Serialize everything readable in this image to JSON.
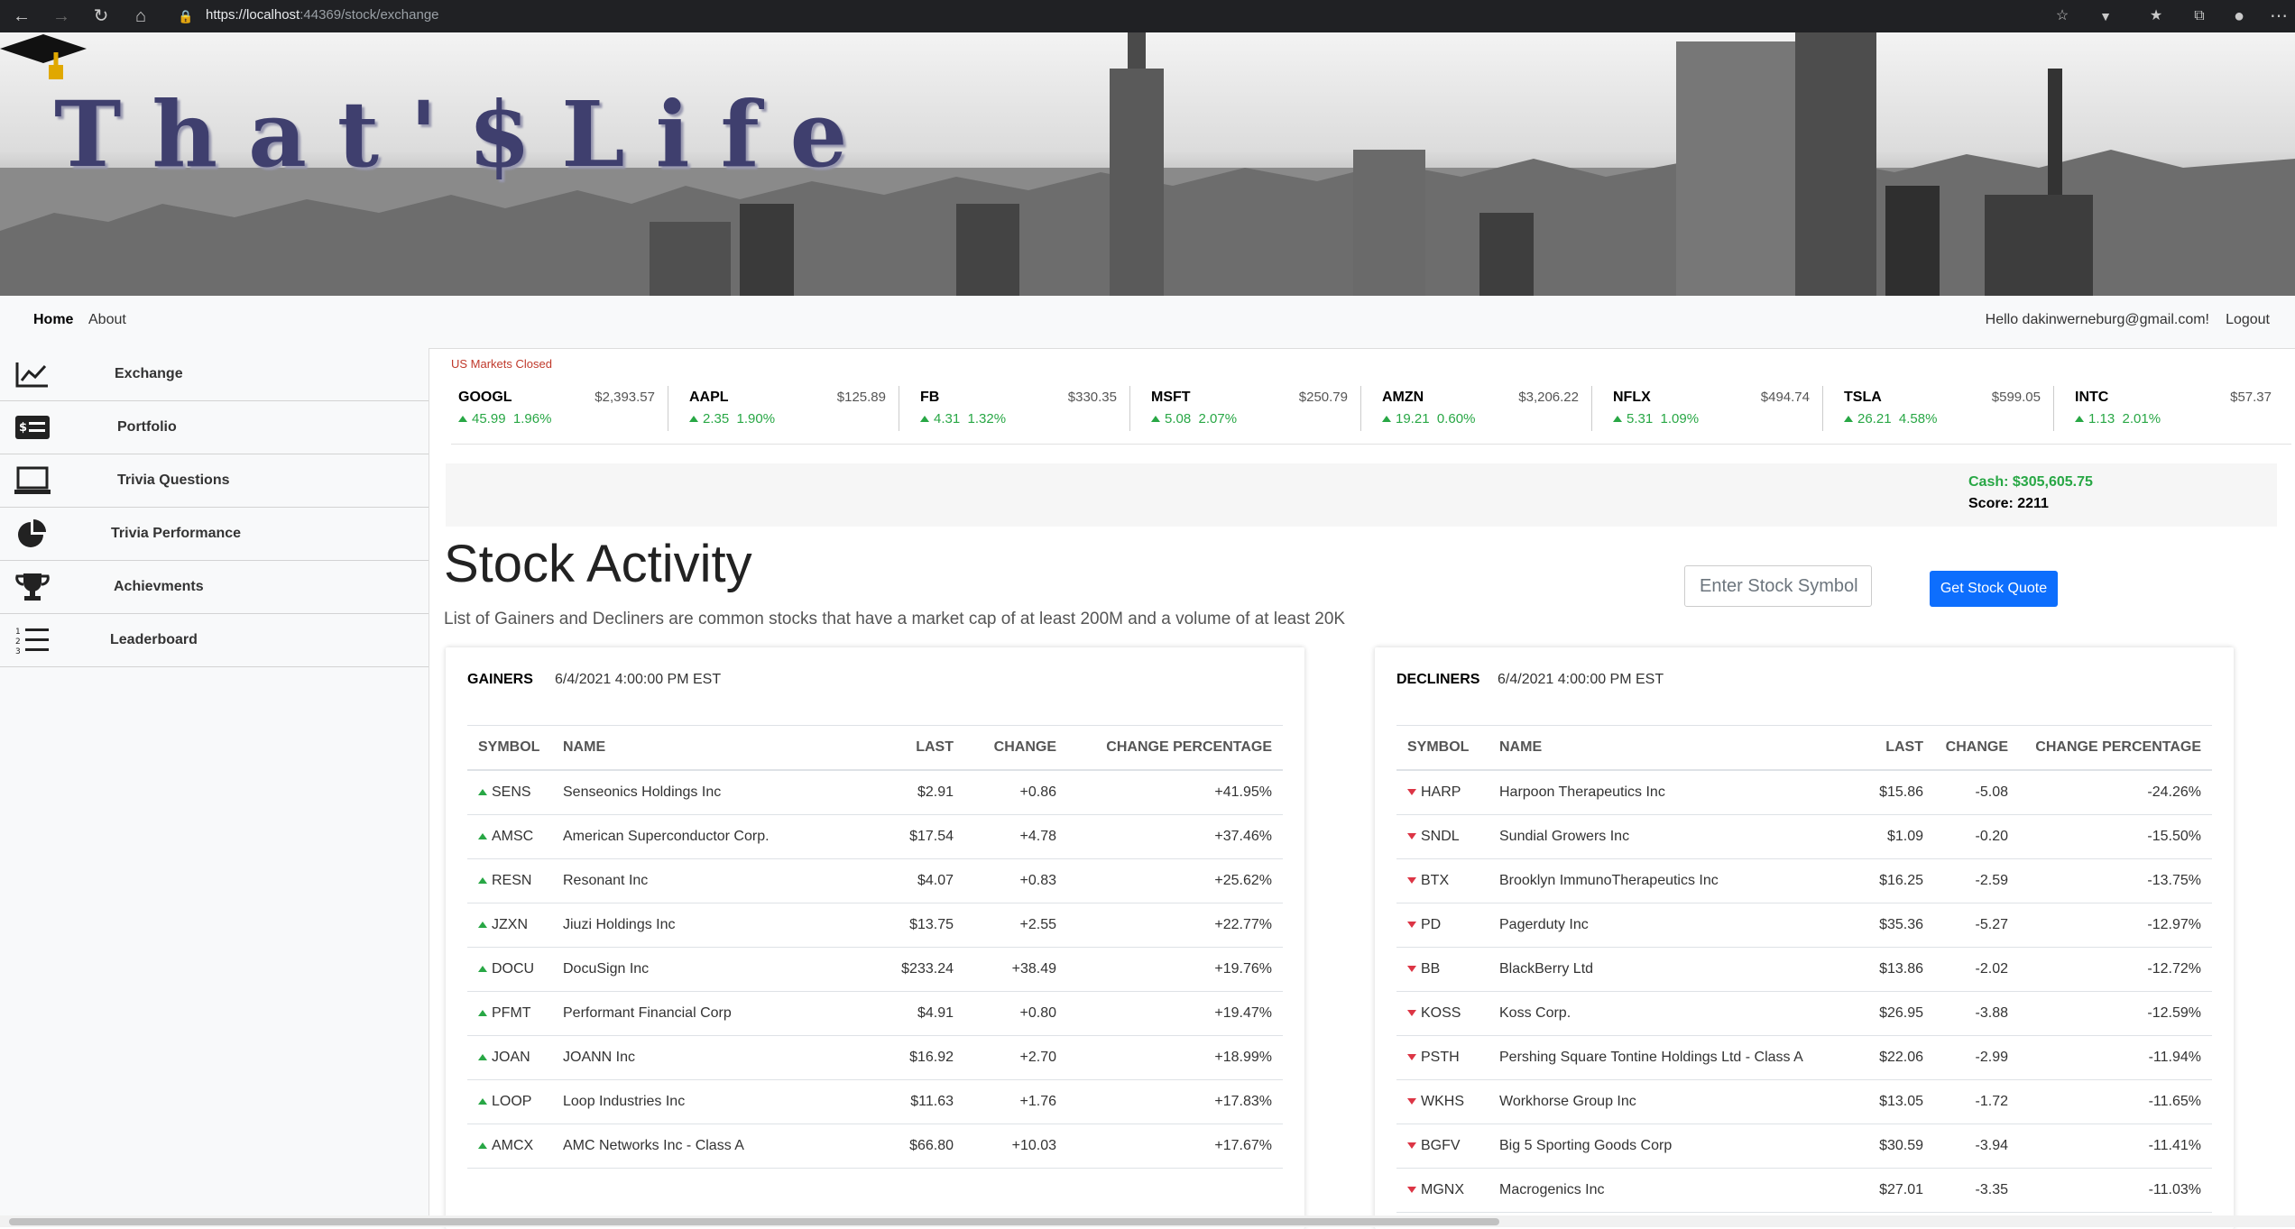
{
  "browser": {
    "url_prefix": "https://localhost",
    "url_rest": ":44369/stock/exchange"
  },
  "banner": {
    "logo_text": "That'$Life"
  },
  "topnav": {
    "home": "Home",
    "about": "About",
    "greeting": "Hello dakinwerneburg@gmail.com!",
    "logout": "Logout"
  },
  "sidebar": {
    "items": [
      {
        "label": "Exchange",
        "icon": "chart-line-icon"
      },
      {
        "label": "Portfolio",
        "icon": "money-check-icon"
      },
      {
        "label": "Trivia Questions",
        "icon": "laptop-icon"
      },
      {
        "label": "Trivia Performance",
        "icon": "pie-chart-icon"
      },
      {
        "label": "Achievments",
        "icon": "trophy-icon"
      },
      {
        "label": "Leaderboard",
        "icon": "ordered-list-icon"
      }
    ]
  },
  "market_status": "US Markets Closed",
  "ticker": [
    {
      "symbol": "GOOGL",
      "price": "$2,393.57",
      "change": "45.99",
      "pct": "1.96%"
    },
    {
      "symbol": "AAPL",
      "price": "$125.89",
      "change": "2.35",
      "pct": "1.90%"
    },
    {
      "symbol": "FB",
      "price": "$330.35",
      "change": "4.31",
      "pct": "1.32%"
    },
    {
      "symbol": "MSFT",
      "price": "$250.79",
      "change": "5.08",
      "pct": "2.07%"
    },
    {
      "symbol": "AMZN",
      "price": "$3,206.22",
      "change": "19.21",
      "pct": "0.60%"
    },
    {
      "symbol": "NFLX",
      "price": "$494.74",
      "change": "5.31",
      "pct": "1.09%"
    },
    {
      "symbol": "TSLA",
      "price": "$599.05",
      "change": "26.21",
      "pct": "4.58%"
    },
    {
      "symbol": "INTC",
      "price": "$57.37",
      "change": "1.13",
      "pct": "2.01%"
    }
  ],
  "account": {
    "cash": "Cash: $305,605.75",
    "score": "Score: 2211"
  },
  "page": {
    "title": "Stock Activity",
    "description": "List of Gainers and Decliners are common stocks that have a market cap of at least 200M and a volume of at least 20K"
  },
  "quote": {
    "placeholder": "Enter Stock Symbol",
    "button": "Get Stock Quote"
  },
  "columns": [
    "SYMBOL",
    "NAME",
    "LAST",
    "CHANGE",
    "CHANGE PERCENTAGE"
  ],
  "gainers": {
    "title": "GAINERS",
    "date": "6/4/2021 4:00:00 PM EST",
    "rows": [
      {
        "symbol": "SENS",
        "name": "Senseonics Holdings Inc",
        "last": "$2.91",
        "change": "+0.86",
        "pct": "+41.95%"
      },
      {
        "symbol": "AMSC",
        "name": "American Superconductor Corp.",
        "last": "$17.54",
        "change": "+4.78",
        "pct": "+37.46%"
      },
      {
        "symbol": "RESN",
        "name": "Resonant Inc",
        "last": "$4.07",
        "change": "+0.83",
        "pct": "+25.62%"
      },
      {
        "symbol": "JZXN",
        "name": "Jiuzi Holdings Inc",
        "last": "$13.75",
        "change": "+2.55",
        "pct": "+22.77%"
      },
      {
        "symbol": "DOCU",
        "name": "DocuSign Inc",
        "last": "$233.24",
        "change": "+38.49",
        "pct": "+19.76%"
      },
      {
        "symbol": "PFMT",
        "name": "Performant Financial Corp",
        "last": "$4.91",
        "change": "+0.80",
        "pct": "+19.47%"
      },
      {
        "symbol": "JOAN",
        "name": "JOANN Inc",
        "last": "$16.92",
        "change": "+2.70",
        "pct": "+18.99%"
      },
      {
        "symbol": "LOOP",
        "name": "Loop Industries Inc",
        "last": "$11.63",
        "change": "+1.76",
        "pct": "+17.83%"
      },
      {
        "symbol": "AMCX",
        "name": "AMC Networks Inc - Class A",
        "last": "$66.80",
        "change": "+10.03",
        "pct": "+17.67%"
      }
    ]
  },
  "decliners": {
    "title": "DECLINERS",
    "date": "6/4/2021 4:00:00 PM EST",
    "rows": [
      {
        "symbol": "HARP",
        "name": "Harpoon Therapeutics Inc",
        "last": "$15.86",
        "change": "-5.08",
        "pct": "-24.26%"
      },
      {
        "symbol": "SNDL",
        "name": "Sundial Growers Inc",
        "last": "$1.09",
        "change": "-0.20",
        "pct": "-15.50%"
      },
      {
        "symbol": "BTX",
        "name": "Brooklyn ImmunoTherapeutics Inc",
        "last": "$16.25",
        "change": "-2.59",
        "pct": "-13.75%"
      },
      {
        "symbol": "PD",
        "name": "Pagerduty Inc",
        "last": "$35.36",
        "change": "-5.27",
        "pct": "-12.97%"
      },
      {
        "symbol": "BB",
        "name": "BlackBerry Ltd",
        "last": "$13.86",
        "change": "-2.02",
        "pct": "-12.72%"
      },
      {
        "symbol": "KOSS",
        "name": "Koss Corp.",
        "last": "$26.95",
        "change": "-3.88",
        "pct": "-12.59%"
      },
      {
        "symbol": "PSTH",
        "name": "Pershing Square Tontine Holdings Ltd - Class A",
        "last": "$22.06",
        "change": "-2.99",
        "pct": "-11.94%"
      },
      {
        "symbol": "WKHS",
        "name": "Workhorse Group Inc",
        "last": "$13.05",
        "change": "-1.72",
        "pct": "-11.65%"
      },
      {
        "symbol": "BGFV",
        "name": "Big 5 Sporting Goods Corp",
        "last": "$30.59",
        "change": "-3.94",
        "pct": "-11.41%"
      },
      {
        "symbol": "MGNX",
        "name": "Macrogenics Inc",
        "last": "$27.01",
        "change": "-3.35",
        "pct": "-11.03%"
      }
    ]
  },
  "colors": {
    "positive": "#28a745",
    "negative": "#dc3545",
    "primary": "#0d6efd"
  }
}
